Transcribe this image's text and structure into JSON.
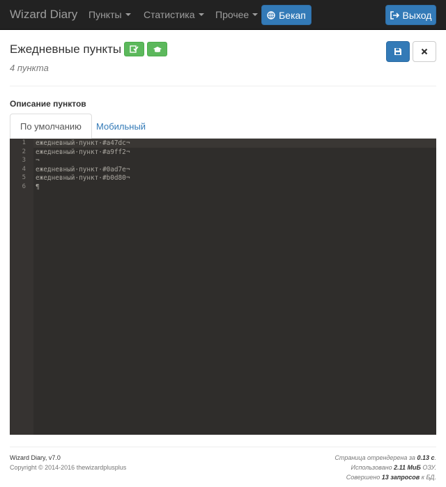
{
  "navbar": {
    "brand": "Wizard Diary",
    "menu": [
      {
        "label": "Пункты"
      },
      {
        "label": "Статистика"
      },
      {
        "label": "Прочее"
      }
    ],
    "backup_label": "Бекап",
    "logout_label": "Выход"
  },
  "header": {
    "title": "Ежедневные пункты",
    "count_text": "4 пункта"
  },
  "description": {
    "label": "Описание пунктов",
    "tabs": [
      {
        "label": "По умолчанию",
        "active": true
      },
      {
        "label": "Мобильный",
        "active": false
      }
    ]
  },
  "editor": {
    "lines": [
      {
        "num": "1",
        "text": "ежедневный·пункт·#a47dc¬"
      },
      {
        "num": "2",
        "text": "ежедневный·пункт·#a9ff2¬"
      },
      {
        "num": "3",
        "text": "¬"
      },
      {
        "num": "4",
        "text": "ежедневный·пункт·#0ad7e¬"
      },
      {
        "num": "5",
        "text": "ежедневный·пункт·#b0d80¬"
      },
      {
        "num": "6",
        "text": "¶"
      }
    ]
  },
  "footer": {
    "version": "Wizard Diary, v7.0",
    "copyright": "Copyright © 2014-2016 thewizardplusplus",
    "render_pre": "Страница отрендерена за ",
    "render_value": "0.13 с",
    "render_post": ".",
    "mem_pre": "Использовано ",
    "mem_value": "2.11 МиБ",
    "mem_post": " ОЗУ.",
    "db_pre": "Совершено ",
    "db_value": "13 запросов",
    "db_post": " к БД."
  },
  "colors": {
    "navbar": "#222222",
    "primary": "#337ab7",
    "success": "#5cb85c",
    "editor_bg": "#2f2d2b"
  }
}
